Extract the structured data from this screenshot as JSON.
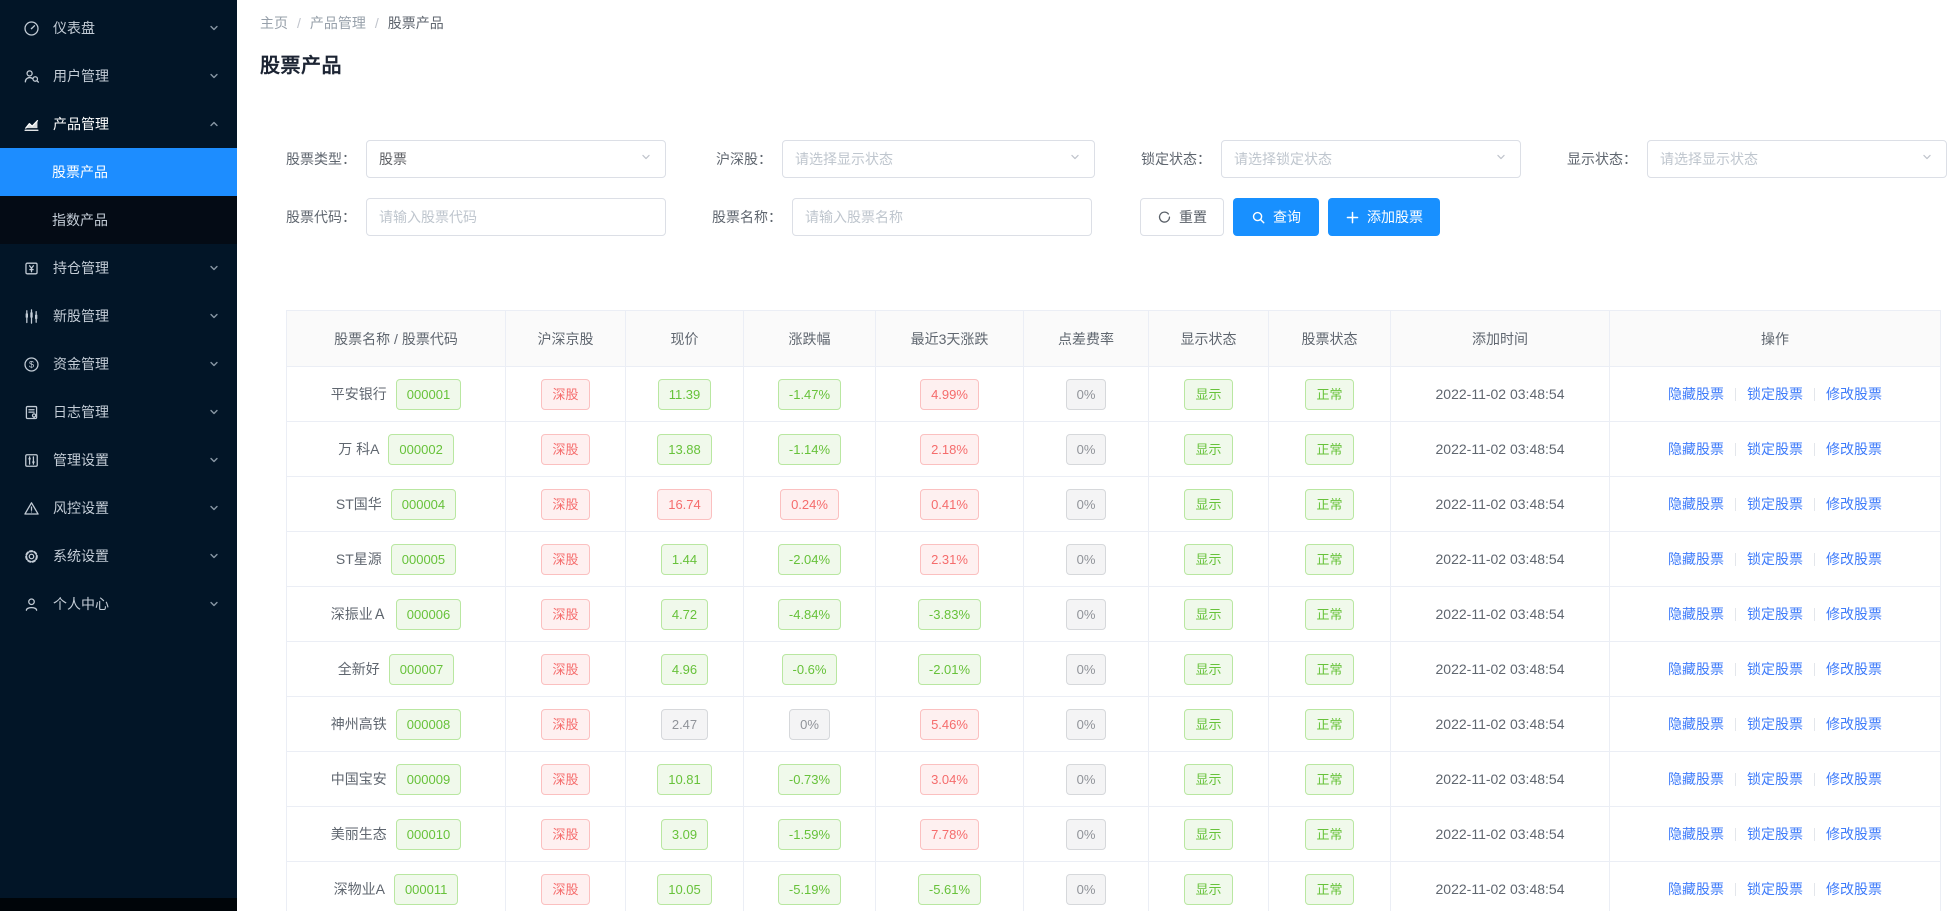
{
  "colors": {
    "sidebar_bg": "#021527",
    "submenu_bg": "#040b15",
    "sidebar_active": "#1d8dff",
    "primary_button": "#1890ff",
    "link": "#3e7bfa",
    "badge_green": "#67c23a",
    "badge_red": "#f56c6c",
    "badge_gray": "#909399"
  },
  "sidebar": {
    "items": [
      {
        "id": "dashboard",
        "label": "仪表盘",
        "icon": "dashboard-icon",
        "state": "collapsed"
      },
      {
        "id": "users",
        "label": "用户管理",
        "icon": "user-search-icon",
        "state": "collapsed"
      },
      {
        "id": "products",
        "label": "产品管理",
        "icon": "area-chart-icon",
        "state": "expanded",
        "children": [
          {
            "id": "stock-products",
            "label": "股票产品",
            "active": true
          },
          {
            "id": "index-products",
            "label": "指数产品",
            "active": false
          }
        ]
      },
      {
        "id": "positions",
        "label": "持仓管理",
        "icon": "position-yuan-icon",
        "state": "collapsed"
      },
      {
        "id": "new-stocks",
        "label": "新股管理",
        "icon": "candlestick-icon",
        "state": "collapsed"
      },
      {
        "id": "funds",
        "label": "资金管理",
        "icon": "money-circle-icon",
        "state": "collapsed"
      },
      {
        "id": "logs",
        "label": "日志管理",
        "icon": "log-document-icon",
        "state": "collapsed"
      },
      {
        "id": "admin-settings",
        "label": "管理设置",
        "icon": "sliders-icon",
        "state": "collapsed"
      },
      {
        "id": "risk-settings",
        "label": "风控设置",
        "icon": "warning-triangle-icon",
        "state": "collapsed"
      },
      {
        "id": "system-settings",
        "label": "系统设置",
        "icon": "gear-icon",
        "state": "collapsed"
      },
      {
        "id": "profile",
        "label": "个人中心",
        "icon": "person-icon",
        "state": "collapsed"
      }
    ]
  },
  "breadcrumb": {
    "items": [
      "主页",
      "产品管理",
      "股票产品"
    ],
    "separator": "/"
  },
  "page": {
    "title": "股票产品"
  },
  "filters": {
    "stock_type": {
      "label": "股票类型：",
      "value": "股票"
    },
    "market": {
      "label": "沪深股：",
      "placeholder": "请选择显示状态"
    },
    "lock_status": {
      "label": "锁定状态：",
      "placeholder": "请选择锁定状态"
    },
    "display_status": {
      "label": "显示状态：",
      "placeholder": "请选择显示状态"
    },
    "stock_code": {
      "label": "股票代码：",
      "placeholder": "请输入股票代码"
    },
    "stock_name": {
      "label": "股票名称：",
      "placeholder": "请输入股票名称"
    }
  },
  "actions_bar": {
    "reset": "重置",
    "search": "查询",
    "add": "添加股票"
  },
  "table": {
    "columns": [
      "股票名称 / 股票代码",
      "沪深京股",
      "现价",
      "涨跌幅",
      "最近3天涨跌",
      "点差费率",
      "显示状态",
      "股票状态",
      "添加时间",
      "操作"
    ],
    "row_actions": [
      "隐藏股票",
      "锁定股票",
      "修改股票"
    ],
    "rows": [
      {
        "name": "平安银行",
        "code": "000001",
        "market": {
          "text": "深股",
          "variant": "red"
        },
        "price": {
          "text": "11.39",
          "variant": "green"
        },
        "change": {
          "text": "-1.47%",
          "variant": "green"
        },
        "three_day": {
          "text": "4.99%",
          "variant": "red"
        },
        "spread": {
          "text": "0%",
          "variant": "gray"
        },
        "display": {
          "text": "显示",
          "variant": "green"
        },
        "status": {
          "text": "正常",
          "variant": "green"
        },
        "added": "2022-11-02 03:48:54"
      },
      {
        "name": "万 科A",
        "code": "000002",
        "market": {
          "text": "深股",
          "variant": "red"
        },
        "price": {
          "text": "13.88",
          "variant": "green"
        },
        "change": {
          "text": "-1.14%",
          "variant": "green"
        },
        "three_day": {
          "text": "2.18%",
          "variant": "red"
        },
        "spread": {
          "text": "0%",
          "variant": "gray"
        },
        "display": {
          "text": "显示",
          "variant": "green"
        },
        "status": {
          "text": "正常",
          "variant": "green"
        },
        "added": "2022-11-02 03:48:54"
      },
      {
        "name": "ST国华",
        "code": "000004",
        "market": {
          "text": "深股",
          "variant": "red"
        },
        "price": {
          "text": "16.74",
          "variant": "red"
        },
        "change": {
          "text": "0.24%",
          "variant": "red"
        },
        "three_day": {
          "text": "0.41%",
          "variant": "red"
        },
        "spread": {
          "text": "0%",
          "variant": "gray"
        },
        "display": {
          "text": "显示",
          "variant": "green"
        },
        "status": {
          "text": "正常",
          "variant": "green"
        },
        "added": "2022-11-02 03:48:54"
      },
      {
        "name": "ST星源",
        "code": "000005",
        "market": {
          "text": "深股",
          "variant": "red"
        },
        "price": {
          "text": "1.44",
          "variant": "green"
        },
        "change": {
          "text": "-2.04%",
          "variant": "green"
        },
        "three_day": {
          "text": "2.31%",
          "variant": "red"
        },
        "spread": {
          "text": "0%",
          "variant": "gray"
        },
        "display": {
          "text": "显示",
          "variant": "green"
        },
        "status": {
          "text": "正常",
          "variant": "green"
        },
        "added": "2022-11-02 03:48:54"
      },
      {
        "name": "深振业Ａ",
        "code": "000006",
        "market": {
          "text": "深股",
          "variant": "red"
        },
        "price": {
          "text": "4.72",
          "variant": "green"
        },
        "change": {
          "text": "-4.84%",
          "variant": "green"
        },
        "three_day": {
          "text": "-3.83%",
          "variant": "green"
        },
        "spread": {
          "text": "0%",
          "variant": "gray"
        },
        "display": {
          "text": "显示",
          "variant": "green"
        },
        "status": {
          "text": "正常",
          "variant": "green"
        },
        "added": "2022-11-02 03:48:54"
      },
      {
        "name": "全新好",
        "code": "000007",
        "market": {
          "text": "深股",
          "variant": "red"
        },
        "price": {
          "text": "4.96",
          "variant": "green"
        },
        "change": {
          "text": "-0.6%",
          "variant": "green"
        },
        "three_day": {
          "text": "-2.01%",
          "variant": "green"
        },
        "spread": {
          "text": "0%",
          "variant": "gray"
        },
        "display": {
          "text": "显示",
          "variant": "green"
        },
        "status": {
          "text": "正常",
          "variant": "green"
        },
        "added": "2022-11-02 03:48:54"
      },
      {
        "name": "神州高铁",
        "code": "000008",
        "market": {
          "text": "深股",
          "variant": "red"
        },
        "price": {
          "text": "2.47",
          "variant": "gray"
        },
        "change": {
          "text": "0%",
          "variant": "gray"
        },
        "three_day": {
          "text": "5.46%",
          "variant": "red"
        },
        "spread": {
          "text": "0%",
          "variant": "gray"
        },
        "display": {
          "text": "显示",
          "variant": "green"
        },
        "status": {
          "text": "正常",
          "variant": "green"
        },
        "added": "2022-11-02 03:48:54"
      },
      {
        "name": "中国宝安",
        "code": "000009",
        "market": {
          "text": "深股",
          "variant": "red"
        },
        "price": {
          "text": "10.81",
          "variant": "green"
        },
        "change": {
          "text": "-0.73%",
          "variant": "green"
        },
        "three_day": {
          "text": "3.04%",
          "variant": "red"
        },
        "spread": {
          "text": "0%",
          "variant": "gray"
        },
        "display": {
          "text": "显示",
          "variant": "green"
        },
        "status": {
          "text": "正常",
          "variant": "green"
        },
        "added": "2022-11-02 03:48:54"
      },
      {
        "name": "美丽生态",
        "code": "000010",
        "market": {
          "text": "深股",
          "variant": "red"
        },
        "price": {
          "text": "3.09",
          "variant": "green"
        },
        "change": {
          "text": "-1.59%",
          "variant": "green"
        },
        "three_day": {
          "text": "7.78%",
          "variant": "red"
        },
        "spread": {
          "text": "0%",
          "variant": "gray"
        },
        "display": {
          "text": "显示",
          "variant": "green"
        },
        "status": {
          "text": "正常",
          "variant": "green"
        },
        "added": "2022-11-02 03:48:54"
      },
      {
        "name": "深物业A",
        "code": "000011",
        "market": {
          "text": "深股",
          "variant": "red"
        },
        "price": {
          "text": "10.05",
          "variant": "green"
        },
        "change": {
          "text": "-5.19%",
          "variant": "green"
        },
        "three_day": {
          "text": "-5.61%",
          "variant": "green"
        },
        "spread": {
          "text": "0%",
          "variant": "gray"
        },
        "display": {
          "text": "显示",
          "variant": "green"
        },
        "status": {
          "text": "正常",
          "variant": "green"
        },
        "added": "2022-11-02 03:48:54"
      }
    ]
  }
}
